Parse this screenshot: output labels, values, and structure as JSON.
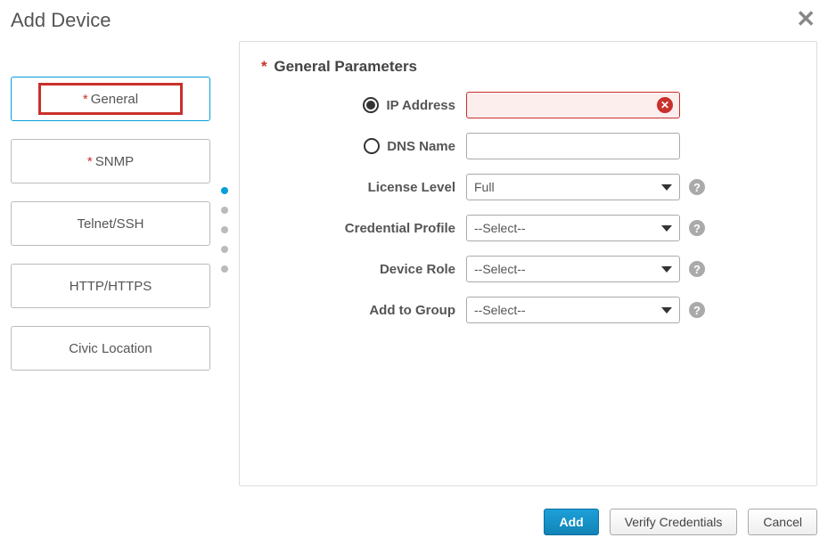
{
  "title": "Add Device",
  "sidebar": {
    "items": [
      {
        "label": "General",
        "required": true,
        "active": true
      },
      {
        "label": "SNMP",
        "required": true,
        "active": false
      },
      {
        "label": "Telnet/SSH",
        "required": false,
        "active": false
      },
      {
        "label": "HTTP/HTTPS",
        "required": false,
        "active": false
      },
      {
        "label": "Civic Location",
        "required": false,
        "active": false
      }
    ]
  },
  "section_title": "General Parameters",
  "section_required": true,
  "form": {
    "ip_label": "IP Address",
    "ip_value": "",
    "ip_selected": true,
    "ip_error": true,
    "dns_label": "DNS Name",
    "dns_value": "",
    "dns_selected": false,
    "license_label": "License Level",
    "license_value": "Full",
    "credential_label": "Credential Profile",
    "credential_value": "--Select--",
    "role_label": "Device Role",
    "role_value": "--Select--",
    "group_label": "Add to Group",
    "group_value": "--Select--"
  },
  "footer": {
    "add": "Add",
    "verify": "Verify Credentials",
    "cancel": "Cancel"
  }
}
